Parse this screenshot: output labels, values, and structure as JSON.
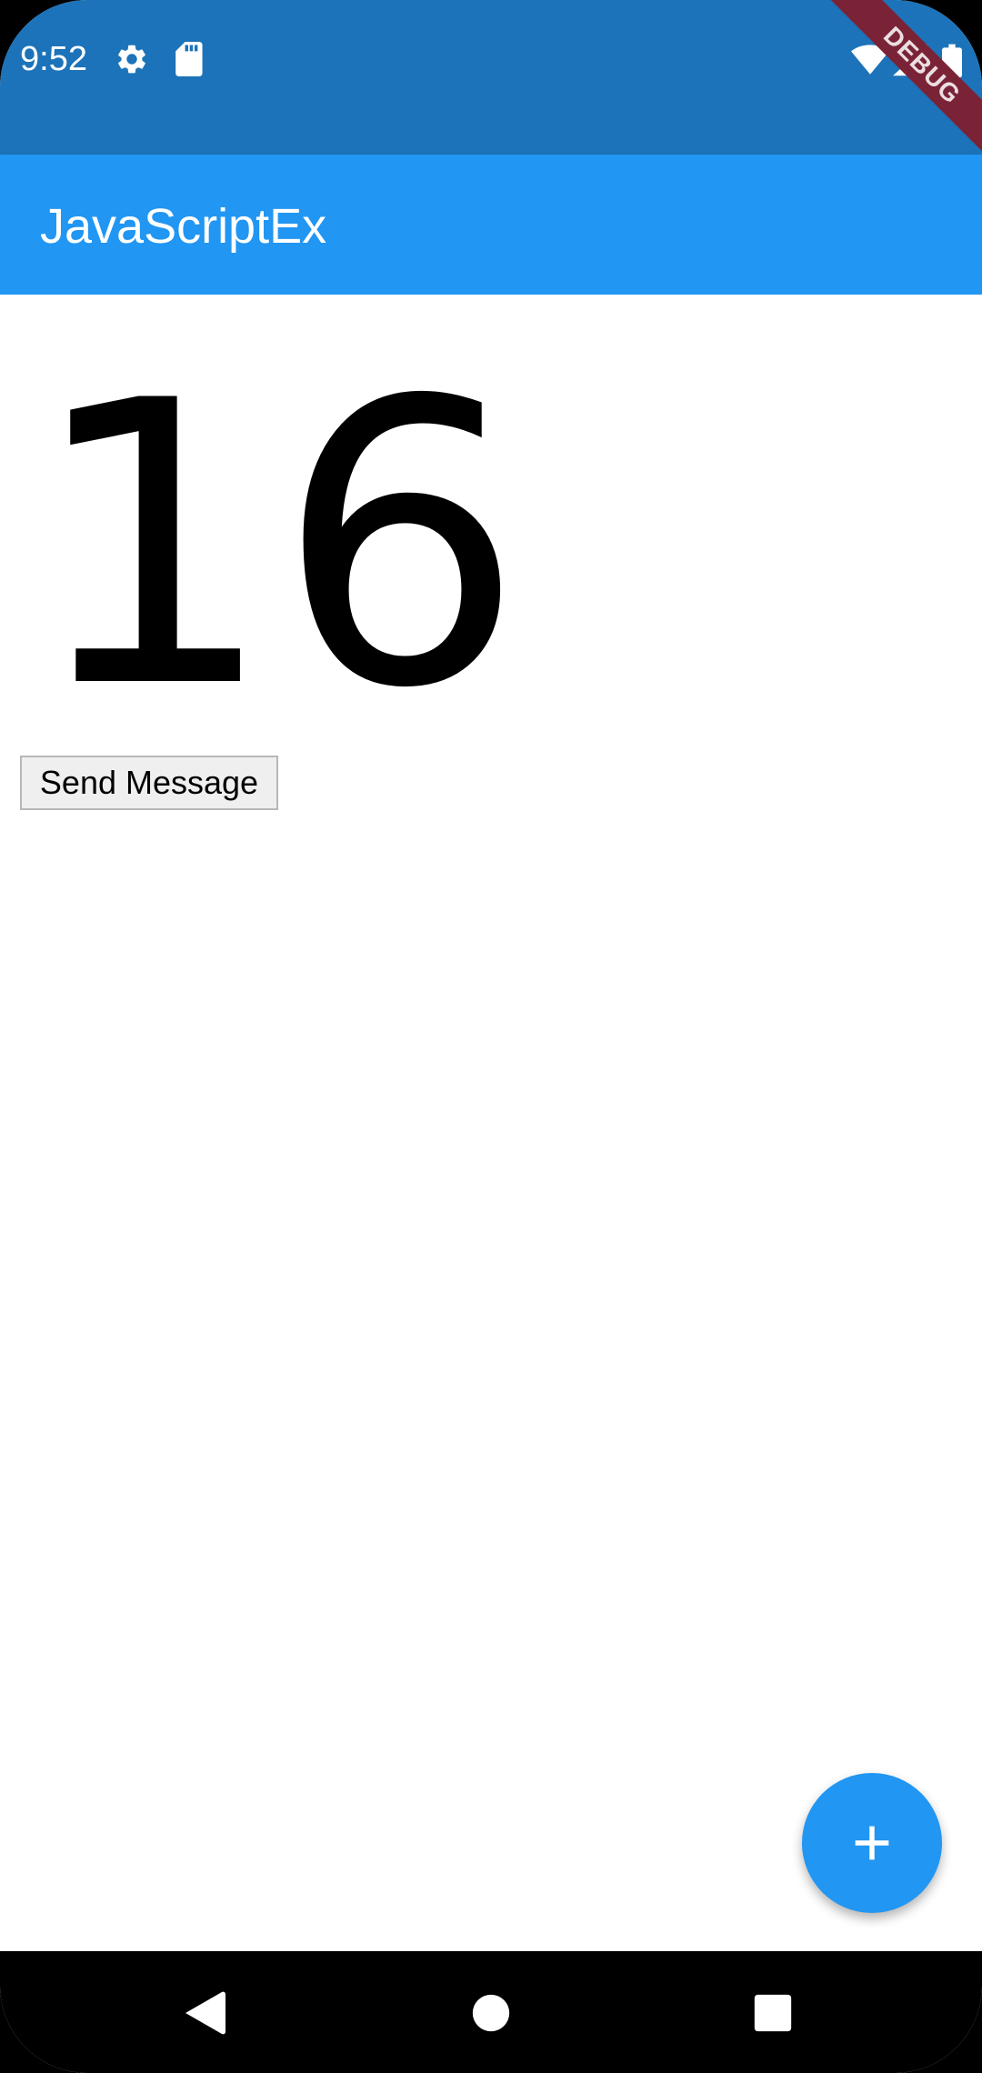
{
  "status_bar": {
    "time": "9:52",
    "icons": [
      "gear-icon",
      "sd-card-icon",
      "wifi-icon",
      "cell-signal-icon",
      "battery-icon"
    ],
    "color": "#1c73b9"
  },
  "debug_banner": {
    "label": "DEBUG",
    "color": "#7a2337"
  },
  "app_bar": {
    "title": "JavaScriptEx",
    "color": "#2196f3"
  },
  "content": {
    "counter": "16",
    "send_button_label": "Send Message"
  },
  "fab": {
    "icon": "plus-icon",
    "color": "#2196f3"
  },
  "nav_bar": {
    "buttons": [
      "back-icon",
      "home-icon",
      "recents-icon"
    ]
  }
}
